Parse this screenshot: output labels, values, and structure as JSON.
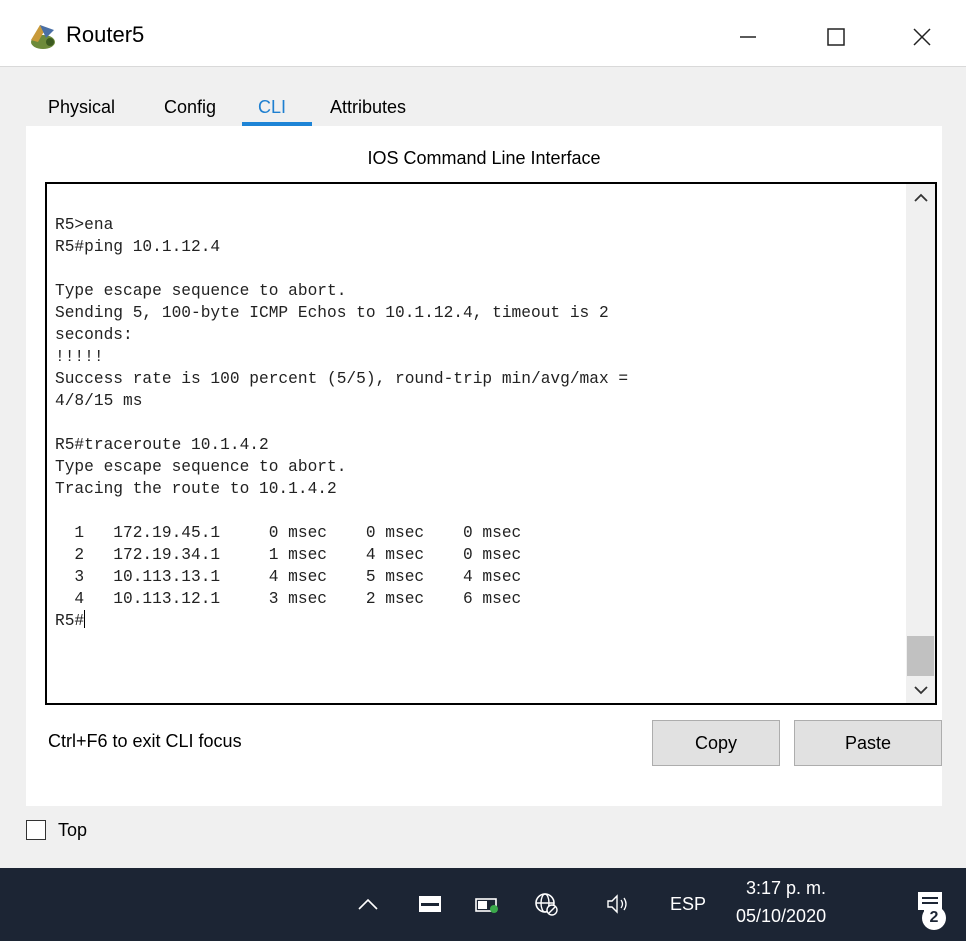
{
  "window": {
    "title": "Router5",
    "app_icon": "router-icon",
    "controls": [
      "minimize-icon",
      "maximize-icon",
      "close-icon"
    ]
  },
  "tabs": [
    {
      "label": "Physical",
      "active": false
    },
    {
      "label": "Config",
      "active": false
    },
    {
      "label": "CLI",
      "active": true
    },
    {
      "label": "Attributes",
      "active": false
    }
  ],
  "cli": {
    "header": "IOS Command Line Interface",
    "lines": [
      "R5>ena",
      "R5#ping 10.1.12.4",
      "",
      "Type escape sequence to abort.",
      "Sending 5, 100-byte ICMP Echos to 10.1.12.4, timeout is 2",
      "seconds:",
      "!!!!!",
      "Success rate is 100 percent (5/5), round-trip min/avg/max =",
      "4/8/15 ms",
      "",
      "R5#traceroute 10.1.4.2",
      "Type escape sequence to abort.",
      "Tracing the route to 10.1.4.2",
      "",
      "  1   172.19.45.1     0 msec    0 msec    0 msec",
      "  2   172.19.34.1     1 msec    4 msec    0 msec",
      "  3   10.113.13.1     4 msec    5 msec    4 msec",
      "  4   10.113.12.1     3 msec    2 msec    6 msec"
    ],
    "prompt": "R5#",
    "exit_hint": "Ctrl+F6 to exit CLI focus",
    "copy_label": "Copy",
    "paste_label": "Paste"
  },
  "options": {
    "top_label": "Top",
    "top_checked": false
  },
  "taskbar": {
    "background": "#1c2534",
    "tray_icons": [
      "chevron-up-icon",
      "keyboard-icon",
      "battery-icon",
      "network-icon",
      "volume-icon"
    ],
    "language": "ESP",
    "time": "3:17 p. m.",
    "date": "05/10/2020",
    "notification_count": "2"
  },
  "colors": {
    "accent": "#1e84d6",
    "client_background": "#f0f0f0"
  }
}
